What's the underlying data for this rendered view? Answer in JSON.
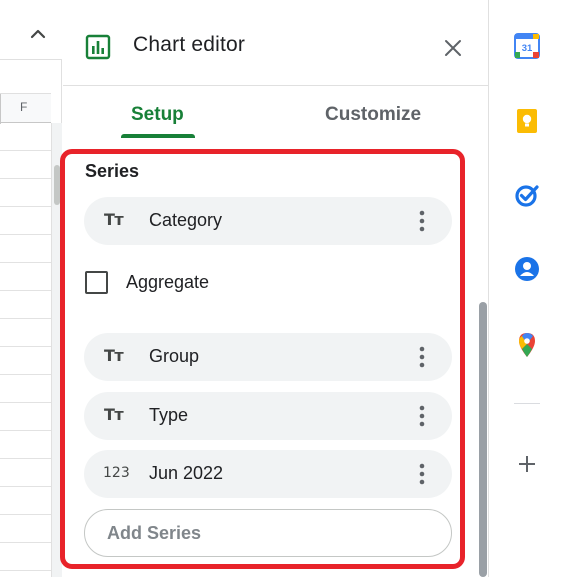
{
  "sheet": {
    "column_label": "F"
  },
  "panel": {
    "title": "Chart editor",
    "tabs": [
      {
        "label": "Setup",
        "active": true
      },
      {
        "label": "Customize",
        "active": false
      }
    ]
  },
  "series_section": {
    "title": "Series",
    "items": [
      {
        "icon": "text-type-icon",
        "icon_text": "Tт",
        "label": "Category"
      },
      {
        "icon": "text-type-icon",
        "icon_text": "Tт",
        "label": "Group"
      },
      {
        "icon": "text-type-icon",
        "icon_text": "Tт",
        "label": "Type"
      },
      {
        "icon": "number-type-icon",
        "icon_text": "123",
        "label": "Jun 2022"
      }
    ],
    "aggregate_label": "Aggregate",
    "aggregate_checked": false,
    "add_series_label": "Add Series"
  },
  "rail": {
    "calendar_day": "31",
    "icons": [
      "calendar-icon",
      "keep-icon",
      "tasks-icon",
      "contacts-icon",
      "maps-icon",
      "add-icon"
    ]
  },
  "colors": {
    "accent_green": "#188038",
    "highlight_red": "#e8232a",
    "chip_bg": "#f1f3f4"
  }
}
